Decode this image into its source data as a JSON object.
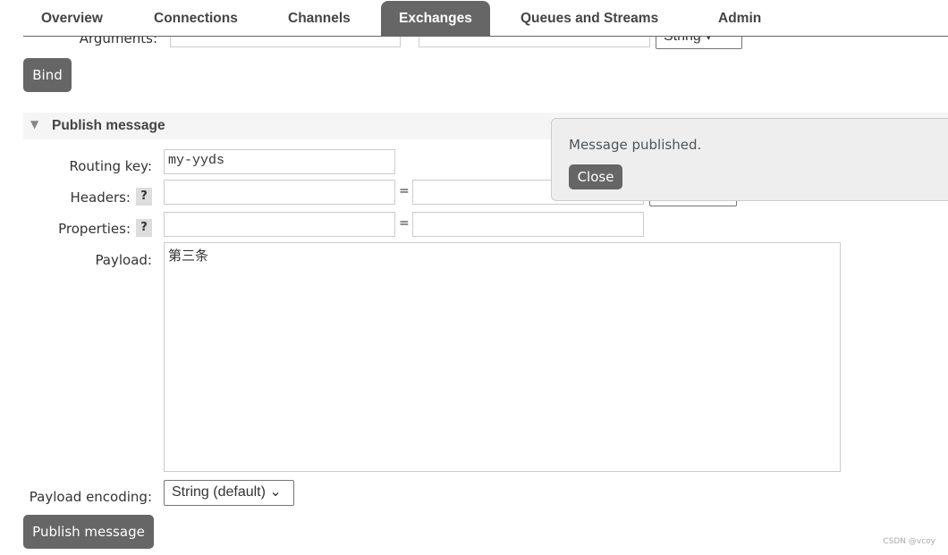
{
  "tabs": [
    {
      "label": "Overview"
    },
    {
      "label": "Connections"
    },
    {
      "label": "Channels"
    },
    {
      "label": "Exchanges",
      "active": true
    },
    {
      "label": "Queues and Streams"
    },
    {
      "label": "Admin"
    }
  ],
  "bind_section": {
    "arguments_label": "Arguments:",
    "arguments_type": "String",
    "bind_button": "Bind"
  },
  "publish": {
    "section_title": "Publish message",
    "routing_key_label": "Routing key:",
    "routing_key_value": "my-yyds",
    "headers_label": "Headers:",
    "properties_label": "Properties:",
    "help": "?",
    "equals": "=",
    "payload_label": "Payload:",
    "payload_value": "第三条",
    "encoding_label": "Payload encoding:",
    "encoding_value": "String (default)",
    "publish_button": "Publish message"
  },
  "popup": {
    "message": "Message published.",
    "close_button": "Close"
  },
  "watermark": "CSDN @vcoy"
}
